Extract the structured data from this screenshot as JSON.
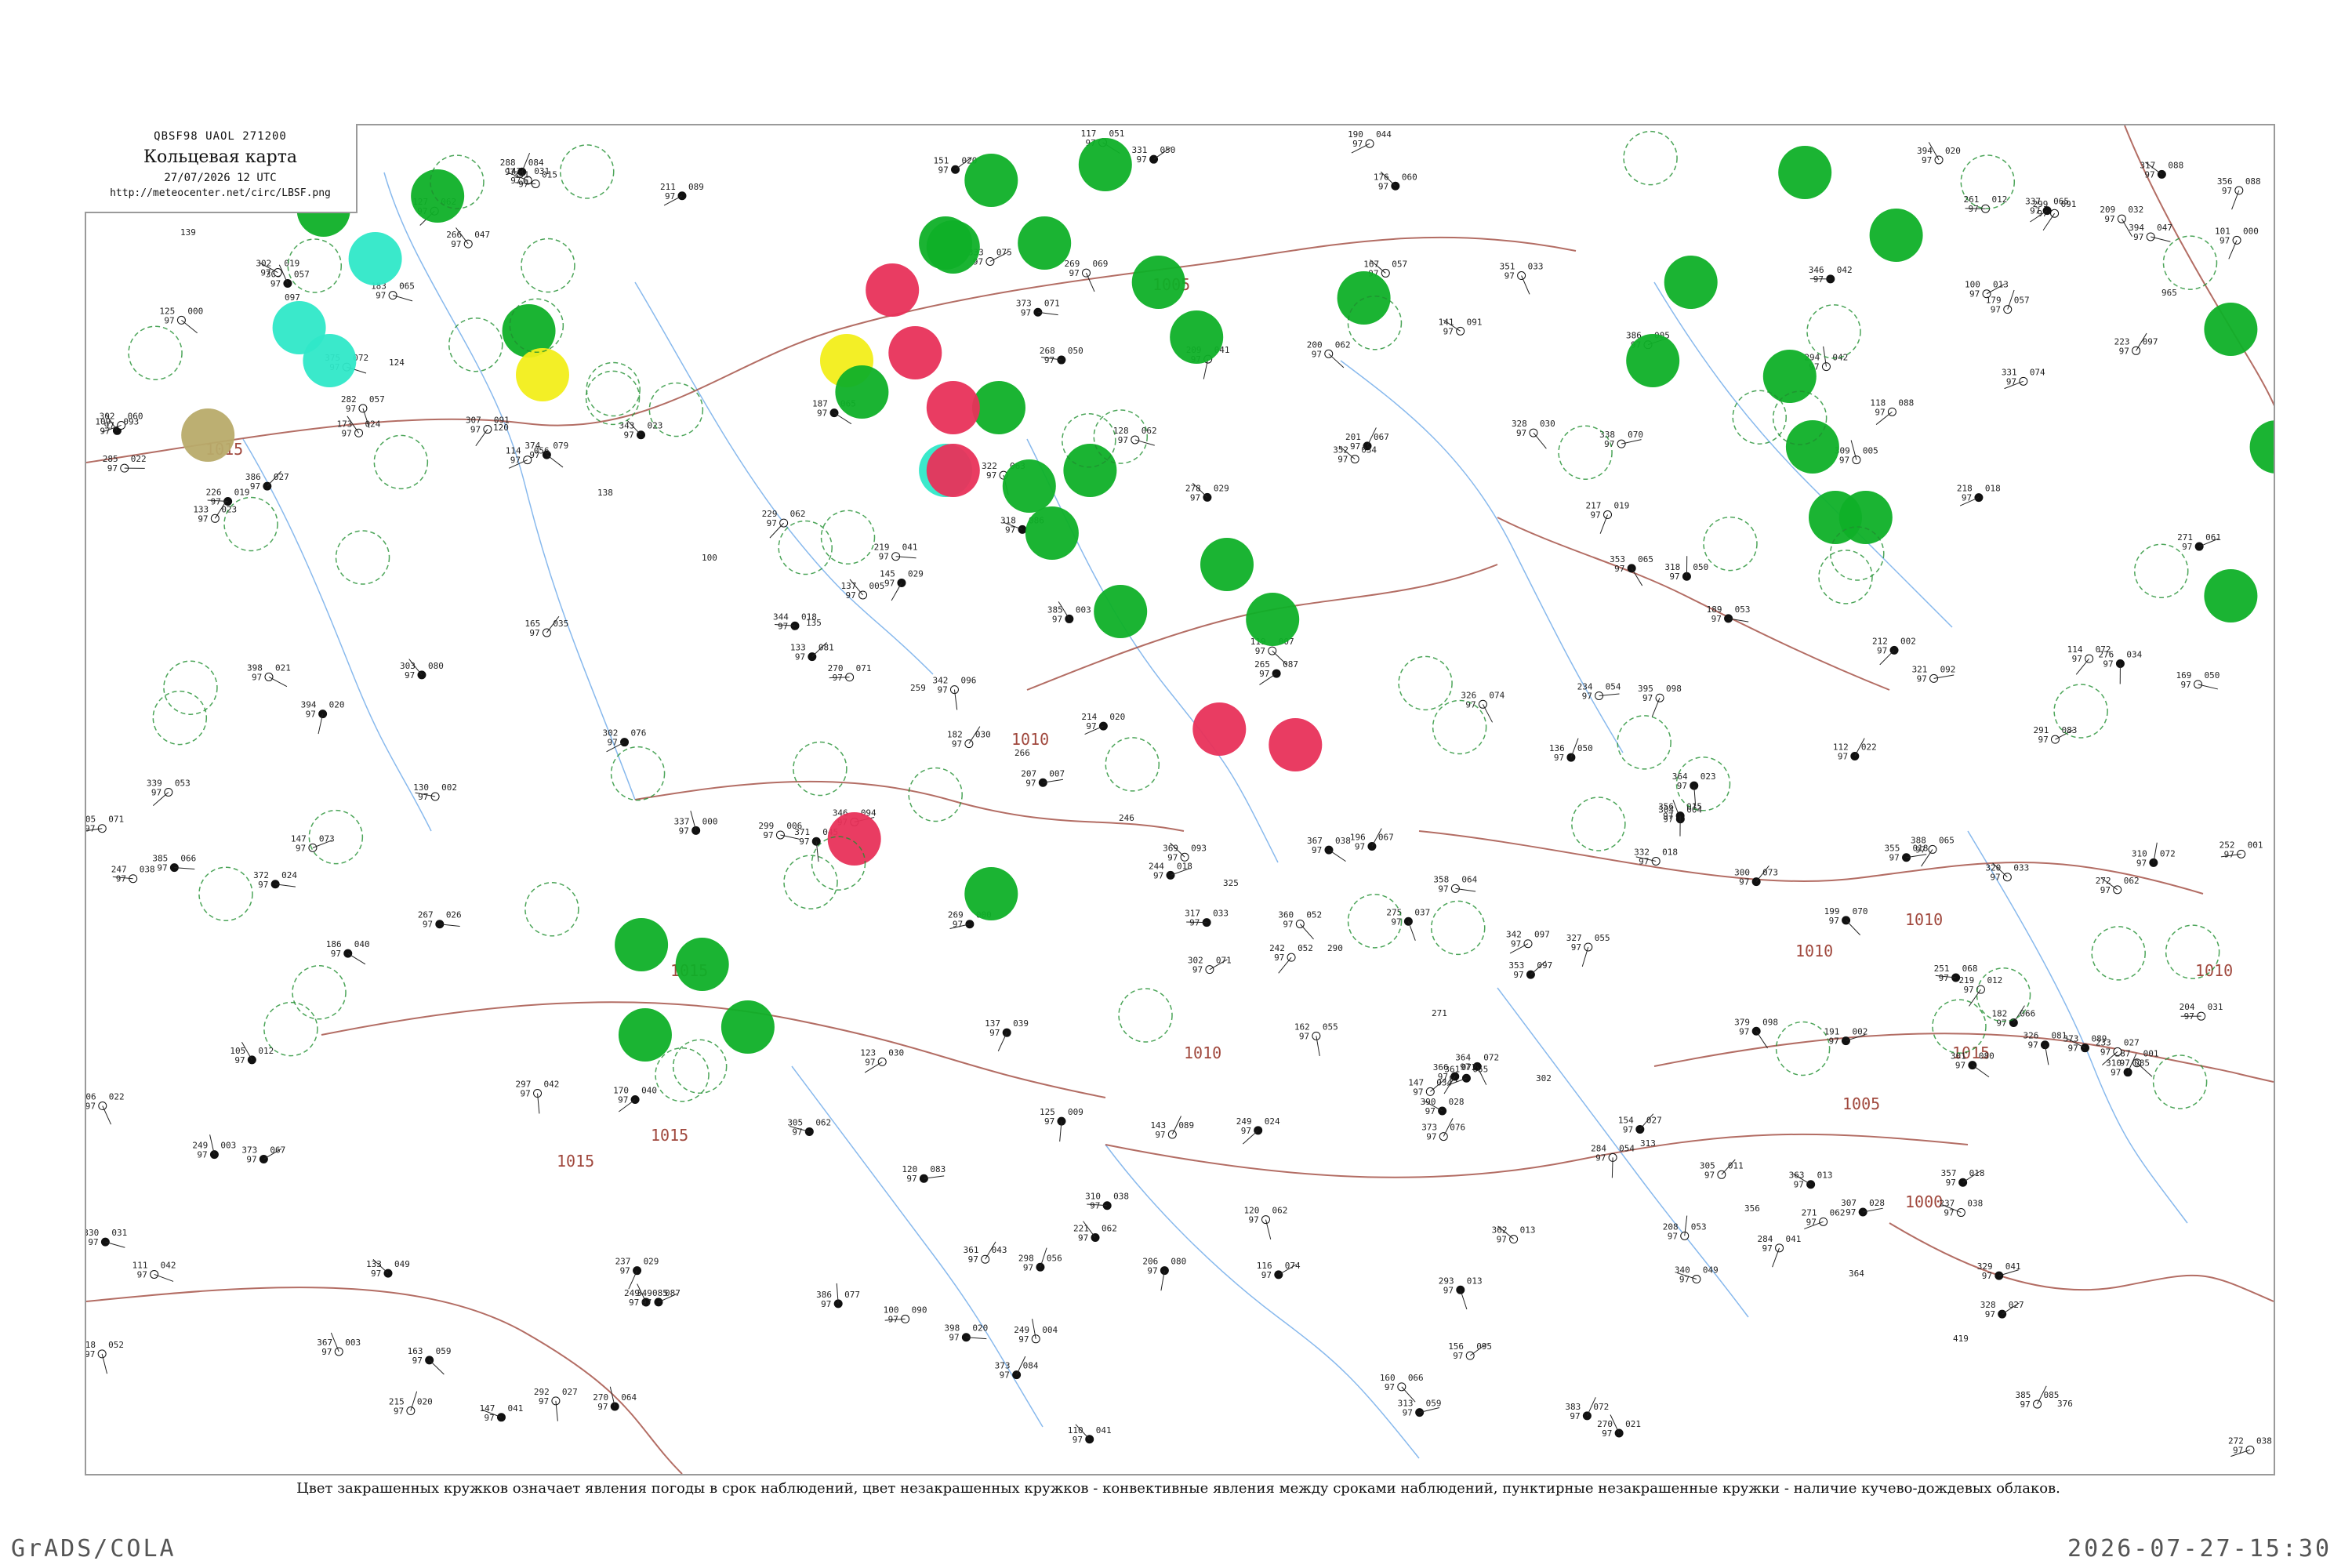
{
  "header": {
    "code": "QBSF98  UAOL  271200",
    "title": "Кольцевая карта",
    "time": "27/07/2026 12 UTC",
    "url": "http://meteocenter.net/circ/LBSF.png"
  },
  "footnote": "Цвет закрашенных кружков означает явления погоды в срок наблюдений, цвет незакрашенных кружков - конвективные явления между сроками наблюдений, пунктирные незакрашенные кружки - наличие кучево-дождевых облаков.",
  "footer": {
    "software": "GrADS/COLA",
    "datetime": "2026-07-27-15:30"
  },
  "isobar_labels": [
    "1015",
    "1005",
    "1010",
    "1015",
    "1010",
    "1015",
    "1010",
    "1015",
    "1010",
    "1005",
    "1000",
    "1010",
    "1015"
  ],
  "colors": {
    "green": "#0fb028",
    "red": "#e8325a",
    "yellow": "#f2ee1a",
    "cyan": "#2fe8c8",
    "olive": "#b8ab6a",
    "isobar": "#a0483d",
    "river": "#6aa8e8",
    "convective_ring": "#1f8f2f"
  },
  "map": {
    "background": "#ffffff",
    "stations_sample": [
      {
        "name": "stn-1",
        "text": "139"
      },
      {
        "name": "stn-2",
        "text": "097"
      },
      {
        "name": "stn-3",
        "text": "124"
      },
      {
        "name": "stn-4",
        "text": "120"
      },
      {
        "name": "stn-5",
        "text": "138"
      },
      {
        "name": "stn-6",
        "text": "100"
      },
      {
        "name": "stn-7",
        "text": "135"
      },
      {
        "name": "stn-8",
        "text": "259"
      },
      {
        "name": "stn-9",
        "text": "266"
      },
      {
        "name": "stn-10",
        "text": "246"
      },
      {
        "name": "stn-11",
        "text": "325"
      },
      {
        "name": "stn-12",
        "text": "290"
      },
      {
        "name": "stn-13",
        "text": "271"
      },
      {
        "name": "stn-14",
        "text": "302"
      },
      {
        "name": "stn-15",
        "text": "313"
      },
      {
        "name": "stn-16",
        "text": "356"
      },
      {
        "name": "stn-17",
        "text": "364"
      },
      {
        "name": "stn-18",
        "text": "419"
      },
      {
        "name": "stn-19",
        "text": "376"
      },
      {
        "name": "stn-20",
        "text": "965"
      }
    ]
  }
}
